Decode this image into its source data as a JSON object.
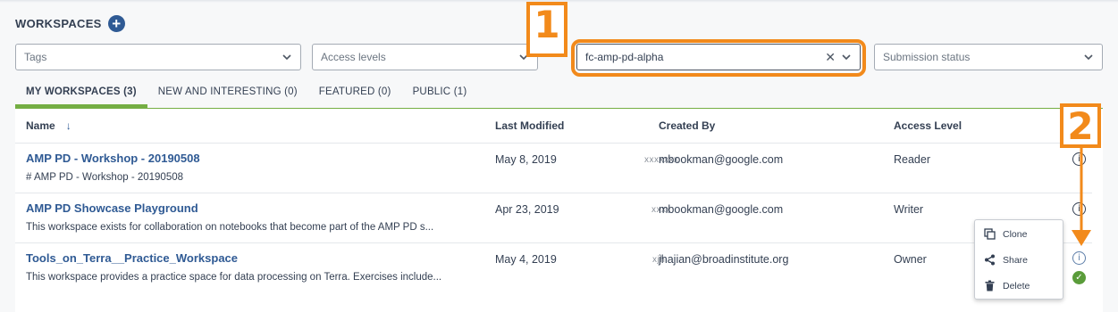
{
  "header": {
    "title": "WORKSPACES",
    "add_icon": "plus-circle-icon"
  },
  "filters": {
    "tags_placeholder": "Tags",
    "access_placeholder": "Access levels",
    "project_value": "fc-amp-pd-alpha",
    "submission_placeholder": "Submission status"
  },
  "callouts": [
    "1",
    "2"
  ],
  "tabs": [
    {
      "label": "MY WORKSPACES (3)"
    },
    {
      "label": "NEW AND INTERESTING (0)"
    },
    {
      "label": "FEATURED (0)"
    },
    {
      "label": "PUBLIC (1)"
    }
  ],
  "table": {
    "headers": {
      "name": "Name",
      "modified": "Last Modified",
      "created": "Created By",
      "access": "Access Level"
    },
    "rows": [
      {
        "name": "AMP PD - Workshop - 20190508",
        "description": "# AMP PD - Workshop - 20190508",
        "modified": "May 8, 2019",
        "created_by": "mbookman@google.com",
        "access": "Reader"
      },
      {
        "name": "AMP PD Showcase Playground",
        "description": "This workspace exists for collaboration on notebooks that become part of the AMP PD s...",
        "modified": "Apr 23, 2019",
        "created_by": "mbookman@google.com",
        "access": "Writer"
      },
      {
        "name": "Tools_on_Terra__Practice_Workspace",
        "description": "This workspace provides a practice space for data processing on Terra. Exercises include...",
        "modified": "May 4, 2019",
        "created_by": "jhajian@broadinstitute.org",
        "access": "Owner"
      }
    ]
  },
  "menu": {
    "clone": "Clone",
    "share": "Share",
    "delete": "Delete"
  },
  "colors": {
    "accent_orange": "#f28a1b",
    "brand_blue": "#2f5a94",
    "tab_green": "#74ae43",
    "success_green": "#5a9c3a"
  }
}
